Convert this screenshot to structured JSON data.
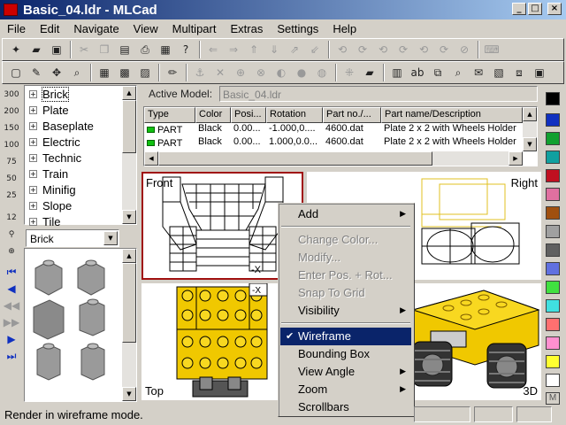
{
  "window": {
    "title": "Basic_04.ldr - MLCad",
    "min": "_",
    "max": "□",
    "close": "×"
  },
  "menu": [
    "File",
    "Edit",
    "Navigate",
    "View",
    "Multipart",
    "Extras",
    "Settings",
    "Help"
  ],
  "zoom_buttons": [
    "300",
    "200",
    "150",
    "100",
    "75",
    "50",
    "25",
    "12"
  ],
  "tree": {
    "items": [
      "Brick",
      "Plate",
      "Baseplate",
      "Electric",
      "Technic",
      "Train",
      "Minifig",
      "Slope",
      "Tile"
    ],
    "selected": "Brick"
  },
  "category_select": "Brick",
  "active_model": {
    "label": "Active Model:",
    "value": "Basic_04.ldr"
  },
  "parts_table": {
    "columns": [
      "Type",
      "Color",
      "Posi...",
      "Rotation",
      "Part no./...",
      "Part name/Description"
    ],
    "rows": [
      [
        "PART",
        "Black",
        "0.00...",
        "-1.000,0....",
        "4600.dat",
        "Plate  2 x  2 with Wheels Holder"
      ],
      [
        "PART",
        "Black",
        "0.00...",
        "1.000,0.0...",
        "4600.dat",
        "Plate  2 x  2 with Wheels Holder"
      ]
    ]
  },
  "views": {
    "front": "Front",
    "right": "Right",
    "top": "Top",
    "threed": "3D"
  },
  "context_menu": [
    {
      "label": "Add",
      "enabled": true,
      "submenu": true
    },
    {
      "sep": true
    },
    {
      "label": "Change Color...",
      "enabled": false
    },
    {
      "label": "Modify...",
      "enabled": false
    },
    {
      "label": "Enter Pos. + Rot...",
      "enabled": false
    },
    {
      "label": "Snap To Grid",
      "enabled": false
    },
    {
      "label": "Visibility",
      "enabled": true,
      "submenu": true
    },
    {
      "sep": true
    },
    {
      "label": "Wireframe",
      "enabled": true,
      "checked": true,
      "highlighted": true
    },
    {
      "label": "Bounding Box",
      "enabled": true
    },
    {
      "label": "View Angle",
      "enabled": true,
      "submenu": true
    },
    {
      "label": "Zoom",
      "enabled": true,
      "submenu": true
    },
    {
      "label": "Scrollbars",
      "enabled": true
    }
  ],
  "palette_colors": [
    "#000000",
    "#1030c0",
    "#10a030",
    "#10a0a0",
    "#c01020",
    "#e070a0",
    "#a05010",
    "#a0a0a0",
    "#606060",
    "#6070e0",
    "#40e040",
    "#40e0e0",
    "#ff7070",
    "#ff90d0",
    "#ffff30",
    "#ffffff"
  ],
  "palette_more": "M",
  "status": {
    "text": "Render in wireframe mode."
  }
}
